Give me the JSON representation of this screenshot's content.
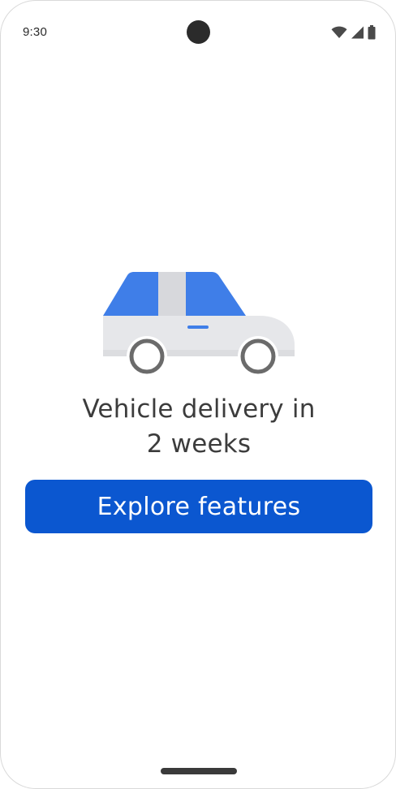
{
  "status_bar": {
    "time": "9:30",
    "icons": [
      "wifi-icon",
      "cellular-signal-icon",
      "battery-icon"
    ]
  },
  "illustration": {
    "icon": "car-icon",
    "colors": {
      "window_blue": "#3f7ee8",
      "pillar_gray": "#d7d8dc",
      "body_gray": "#e6e7ea",
      "door_handle": "#3f7ee8",
      "wheel_stroke": "#6b6b6b"
    }
  },
  "main": {
    "headline_line1": "Vehicle delivery in",
    "headline_line2": "2 weeks",
    "cta_label": "Explore features"
  },
  "colors": {
    "primary": "#0b57d0",
    "text": "#3c3c3c"
  }
}
